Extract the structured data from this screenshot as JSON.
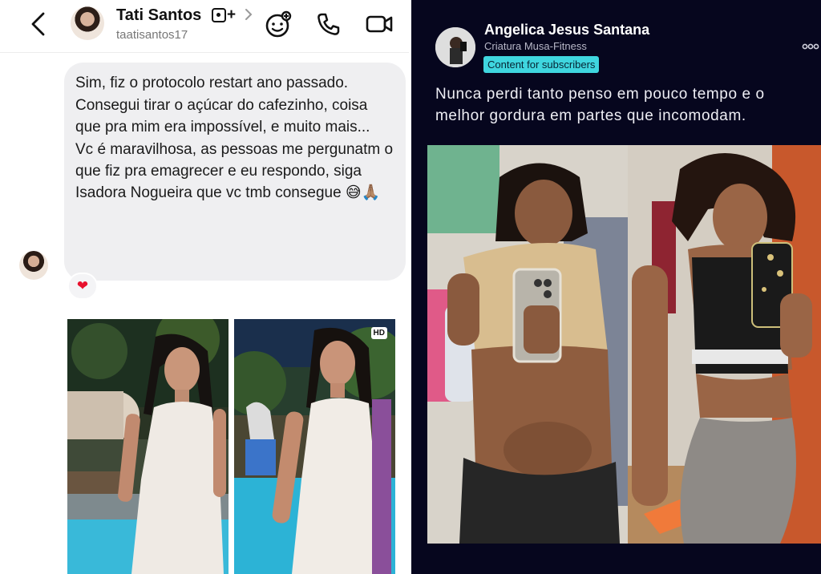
{
  "chat": {
    "contact_name": "Tati Santos",
    "contact_handle": "taatisantos17",
    "close_friends_badge": "+",
    "messages": [
      "Sim, fiz o protocolo restart ano passado.",
      "Consegui tirar o açúcar do cafezinho, coisa que pra mim era impossível, e muito mais...",
      "Vc é maravilhosa,  as pessoas me pergunatm o que fiz pra emagrecer e eu respondo,  siga Isadora Nogueira que vc tmb consegue 😅🙏🏽"
    ],
    "reaction": "❤",
    "photo_badge": "HD"
  },
  "post": {
    "author_name": "Angelica Jesus Santana",
    "author_subtitle": "Criatura Musa-Fitness",
    "badge": "Content for subscribers",
    "text": "Nunca perdi tanto penso em pouco tempo e o melhor gordura em partes que incomodam."
  },
  "icons": [
    "chevron-left-icon",
    "chevron-right-icon",
    "sticker-icon",
    "phone-icon",
    "video-call-icon",
    "heart-reaction-icon",
    "more-options-icon"
  ],
  "colors": {
    "bubble": "#efeff1",
    "post_background": "#06061e",
    "badge": "#3fd6df",
    "reaction": "#e8112d"
  }
}
